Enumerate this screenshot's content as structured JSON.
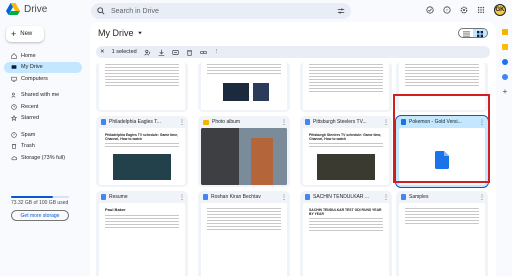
{
  "app": {
    "name": "Drive"
  },
  "search": {
    "placeholder": "Search in Drive"
  },
  "user": {
    "initials": "GK"
  },
  "sidebar": {
    "new_label": "New",
    "items": [
      {
        "label": "Home"
      },
      {
        "label": "My Drive"
      },
      {
        "label": "Computers"
      },
      {
        "label": "Shared with me"
      },
      {
        "label": "Recent"
      },
      {
        "label": "Starred"
      },
      {
        "label": "Spam"
      },
      {
        "label": "Trash"
      },
      {
        "label": "Storage (73% full)"
      }
    ],
    "storage_text": "73.32 GB of 100 GB used",
    "storage_fraction": 0.73,
    "get_storage": "Get more storage"
  },
  "main": {
    "title": "My Drive",
    "selection": {
      "count_label": "1 selected"
    }
  },
  "files": [
    {
      "name": "Philadelphia Eagles T...",
      "type": "doc",
      "preview_title": "Philadelphia Eagles TV schedule: Game time, Channel, How to watch"
    },
    {
      "name": "Photo album",
      "type": "folder"
    },
    {
      "name": "Pittsburgh Steelers TV...",
      "type": "doc",
      "preview_title": "Pittsburgh Steelers TV schedule: Game time, Channel, How to watch"
    },
    {
      "name": "Pokemon - Gold Versi...",
      "type": "file"
    },
    {
      "name": "Resume",
      "type": "doc",
      "preview_title": "Paul Baker"
    },
    {
      "name": "Roshan Kiran Bechtav",
      "type": "doc",
      "preview_title": ""
    },
    {
      "name": "SACHIN TENDULKAR ...",
      "type": "doc",
      "preview_title": "SACHIN TENDULKAR TEST ODI RUNS YEAR BY YEAR"
    },
    {
      "name": "Samples",
      "type": "doc",
      "preview_title": ""
    }
  ],
  "colors": {
    "accent": "#0b57d0",
    "selected_bg": "#c2e7ff",
    "highlight": "#d21f1f"
  }
}
